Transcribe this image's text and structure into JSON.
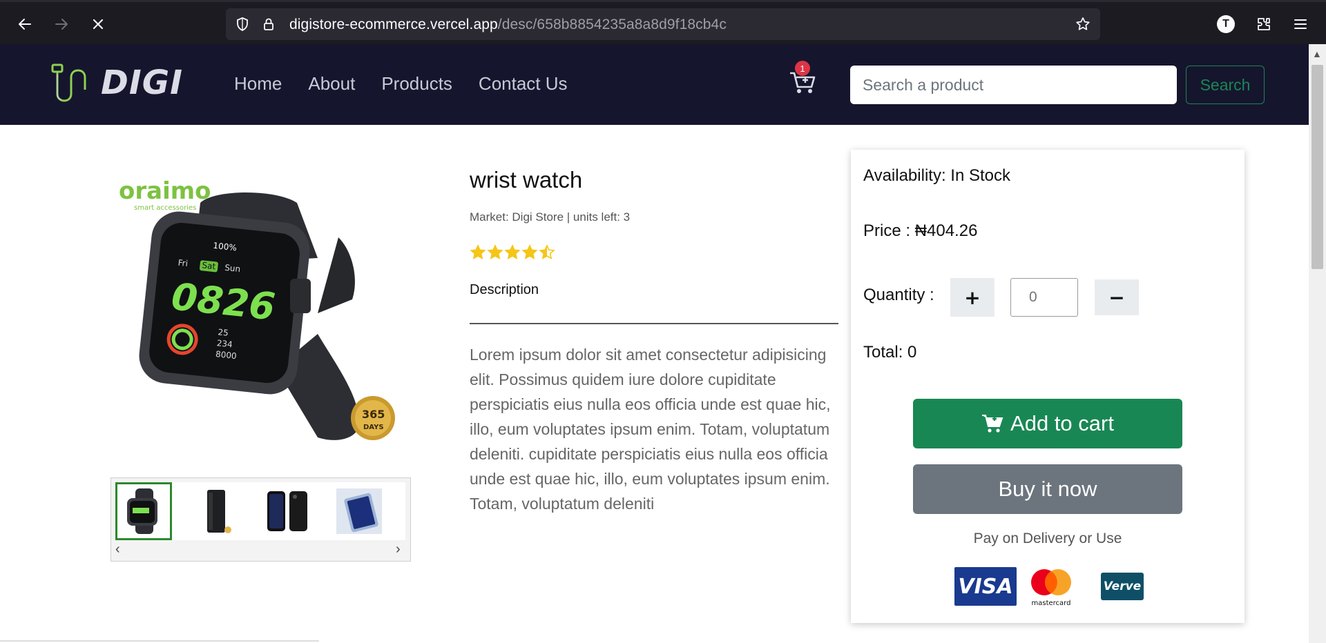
{
  "browser": {
    "url_domain": "digistore-ecommerce.vercel.app",
    "url_path": "/desc/658b8854235a8a8d9f18cb4c",
    "profile_initial": "T"
  },
  "header": {
    "logo_text": "DIGI",
    "nav": [
      "Home",
      "About",
      "Products",
      "Contact Us"
    ],
    "cart_count": "1",
    "search_placeholder": "Search a product",
    "search_button": "Search"
  },
  "product": {
    "title": "wrist watch",
    "market_line": "Market: Digi Store | units left: 3",
    "rating": 4.5,
    "rating_max": 5,
    "description_label": "Description",
    "description": "Lorem ipsum dolor sit amet consectetur adipisicing elit. Possimus quidem iure dolore cupiditate perspiciatis eius nulla eos officia unde est quae hic, illo, eum voluptates ipsum enim. Totam, voluptatum deleniti. cupiditate perspiciatis eius nulla eos officia unde est quae hic, illo, eum voluptates ipsum enim. Totam, voluptatum deleniti",
    "image_brand": "oraimo",
    "image_brand_sub": "smart accessories",
    "watch_time": "0826",
    "watch_days": [
      "Fri",
      "Sat",
      "Sun"
    ],
    "watch_battery": "100%",
    "watch_stats": [
      "25",
      "234",
      "8000"
    ],
    "guarantee_top": "365",
    "guarantee_bottom": "DAYS"
  },
  "thumbnails": [
    "smart-watch",
    "power-bank",
    "smartphone",
    "tablet"
  ],
  "purchase": {
    "availability": "Availability: In Stock",
    "price": "Price : ₦404.26",
    "quantity_label": "Quantity :",
    "quantity_value": "0",
    "total": "Total: 0",
    "add_to_cart": "Add to cart",
    "buy_now": "Buy it now",
    "pay_note": "Pay on Delivery or Use",
    "payment_methods": {
      "visa": "VISA",
      "mastercard": "mastercard",
      "verve": "Verve"
    }
  },
  "colors": {
    "header_bg": "#16152e",
    "accent_green": "#198754",
    "secondary_grey": "#6c757d",
    "star_gold": "#f5c518",
    "badge_red": "#dc3545"
  }
}
